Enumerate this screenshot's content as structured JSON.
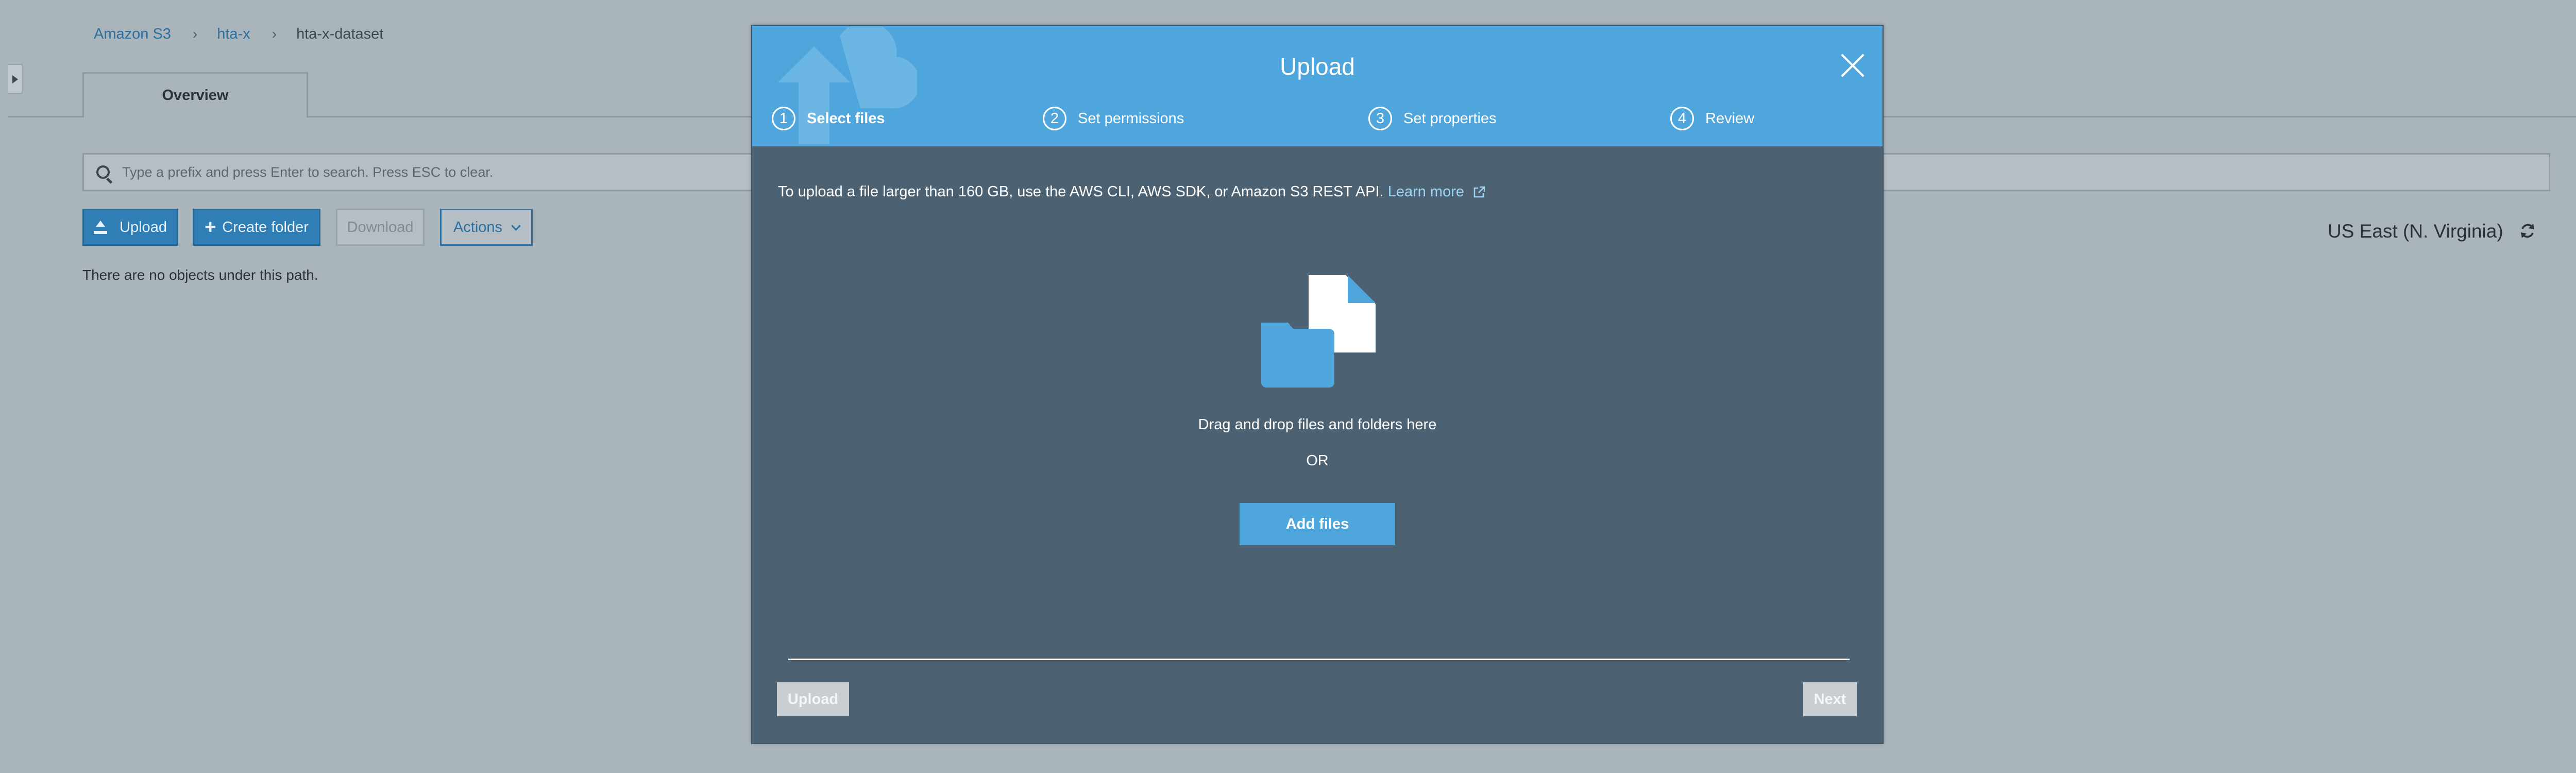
{
  "breadcrumb": {
    "items": [
      "Amazon S3",
      "hta-x",
      "hta-x-dataset"
    ]
  },
  "tabs": [
    {
      "label": "Overview"
    }
  ],
  "search": {
    "placeholder": "Type a prefix and press Enter to search. Press ESC to clear."
  },
  "toolbar": {
    "upload_label": "Upload",
    "create_folder_label": "Create folder",
    "download_label": "Download",
    "actions_label": "Actions"
  },
  "empty_message": "There are no objects under this path.",
  "region": "US East (N. Virginia)",
  "modal": {
    "title": "Upload",
    "steps": [
      {
        "num": "1",
        "label": "Select files",
        "active": true
      },
      {
        "num": "2",
        "label": "Set permissions",
        "active": false
      },
      {
        "num": "3",
        "label": "Set properties",
        "active": false
      },
      {
        "num": "4",
        "label": "Review",
        "active": false
      }
    ],
    "info_text": "To upload a file larger than 160 GB, use the AWS CLI, AWS SDK, or Amazon S3 REST API.",
    "learn_more": "Learn more",
    "drop_text": "Drag and drop files and folders here",
    "or_text": "OR",
    "add_files_label": "Add files",
    "upload_label": "Upload",
    "next_label": "Next"
  },
  "colors": {
    "modal_header": "#4ea6dc",
    "modal_body": "#4c6272",
    "accent": "#4ea6dc",
    "backdrop": "#a9b4bb"
  }
}
